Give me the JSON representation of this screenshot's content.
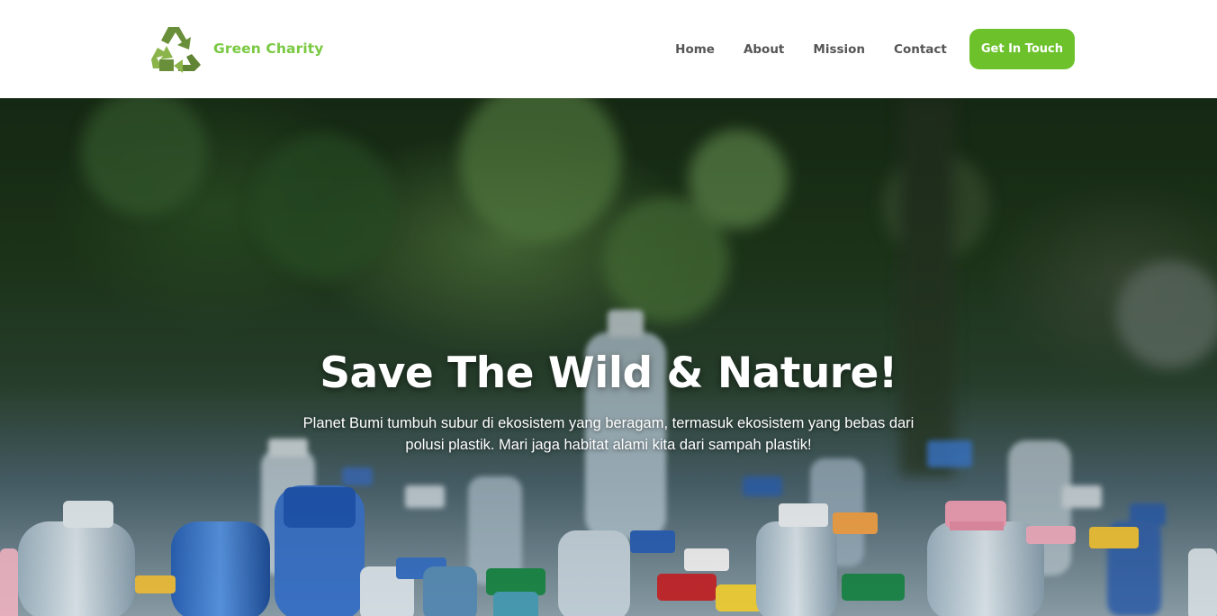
{
  "brand": {
    "name": "Green Charity",
    "logo_icon": "recycle-icon",
    "colors": {
      "logo_dark": "#6a8f3a",
      "logo_light": "#8bb54a",
      "text": "#7ac943"
    }
  },
  "nav": {
    "items": [
      {
        "label": "Home"
      },
      {
        "label": "About"
      },
      {
        "label": "Mission"
      },
      {
        "label": "Contact"
      }
    ],
    "cta_label": "Get In Touch",
    "cta_color": "#6dc22c"
  },
  "hero": {
    "title": "Save The Wild & Nature!",
    "description": "Planet Bumi tumbuh subur di ekosistem yang beragam, termasuk ekosistem yang bebas dari polusi plastik. Mari jaga habitat alami kita dari sampah plastik!",
    "background": "plastic-bottles-photo"
  }
}
